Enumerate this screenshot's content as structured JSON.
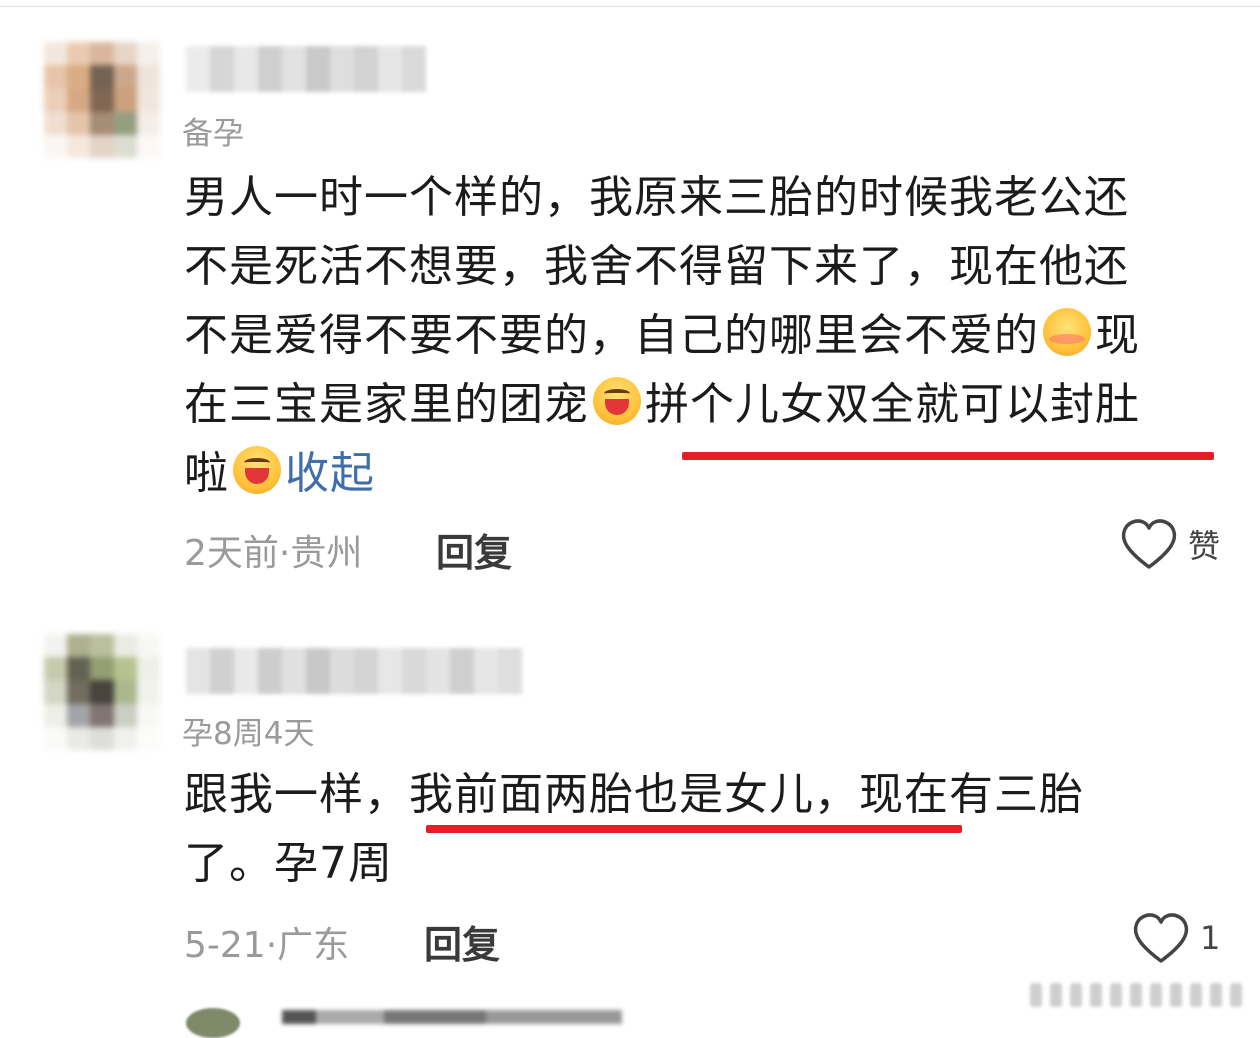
{
  "comments": [
    {
      "tag": "备孕",
      "text_lines": [
        "男人一时一个样的，我原来三胎的时候我老公还",
        "不是死活不想要，我舍不得留下来了，现在他还",
        "不是爱得不要不要的，自己的哪里会不爱的",
        "现",
        "在三宝是家里的团宠",
        "拼个儿女双全就可以封肚",
        "啦"
      ],
      "collapse_label": "收起",
      "time_location": "2天前·贵州",
      "reply_label": "回复",
      "like_label": "赞",
      "emojis": [
        "shy-face-emoji",
        "grin-emoji",
        "grin-emoji"
      ]
    },
    {
      "tag": "孕8周4天",
      "text_lines": [
        "跟我一样，",
        "我前面两胎也是女儿，",
        "现在有三胎",
        "了。孕7周"
      ],
      "time_location": "5-21·广东",
      "reply_label": "回复",
      "like_count": "1"
    }
  ],
  "colors": {
    "underline": "#e41f26",
    "link": "#3f6ea8",
    "meta": "#9a9a9a"
  }
}
